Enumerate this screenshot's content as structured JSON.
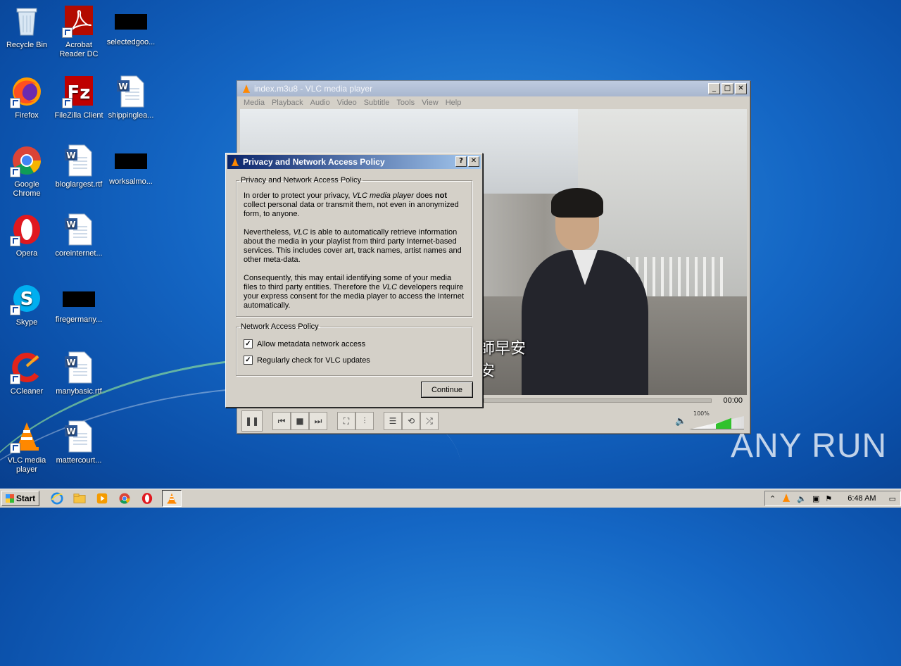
{
  "desktop": {
    "icons": [
      {
        "label": "Recycle Bin"
      },
      {
        "label": "Acrobat Reader DC"
      },
      {
        "label": "selectedgoo..."
      },
      {
        "label": "Firefox"
      },
      {
        "label": "FileZilla Client"
      },
      {
        "label": "shippinglea..."
      },
      {
        "label": "Google Chrome"
      },
      {
        "label": "bloglargest.rtf"
      },
      {
        "label": "worksalmo..."
      },
      {
        "label": "Opera"
      },
      {
        "label": "coreinternet..."
      },
      {
        "label": "Skype"
      },
      {
        "label": "firegermany..."
      },
      {
        "label": "CCleaner"
      },
      {
        "label": "manybasic.rtf"
      },
      {
        "label": "VLC media player"
      },
      {
        "label": "mattercourt..."
      }
    ],
    "watermark": "ANY RUN"
  },
  "vlc": {
    "title": "index.m3u8 - VLC media player",
    "menu": [
      "Media",
      "Playback",
      "Audio",
      "Video",
      "Subtitle",
      "Tools",
      "View",
      "Help"
    ],
    "subtitle_line1": "師早安",
    "subtitle_line2": "安",
    "time": "00:00",
    "volume": "100%"
  },
  "dialog": {
    "title": "Privacy and Network Access Policy",
    "help_btn": "?",
    "close_btn": "✕",
    "section1_legend": "Privacy and Network Access Policy",
    "p1_a": "In order to protect your privacy, ",
    "p1_em": "VLC media player",
    "p1_b": " does ",
    "p1_strong": "not",
    "p1_c": " collect personal data or transmit them, not even in anonymized form, to anyone.",
    "p2_a": "Nevertheless, ",
    "p2_em": "VLC",
    "p2_b": " is able to automatically retrieve information about the media in your playlist from third party Internet-based services. This includes cover art, track names, artist names and other meta-data.",
    "p3_a": "Consequently, this may entail identifying some of your media files to third party entities. Therefore the ",
    "p3_em": "VLC",
    "p3_b": " developers require your express consent for the media player to access the Internet automatically.",
    "section2_legend": "Network Access Policy",
    "check1": "Allow metadata network access",
    "check2": "Regularly check for VLC updates",
    "continue": "Continue"
  },
  "taskbar": {
    "start": "Start",
    "clock": "6:48 AM"
  }
}
